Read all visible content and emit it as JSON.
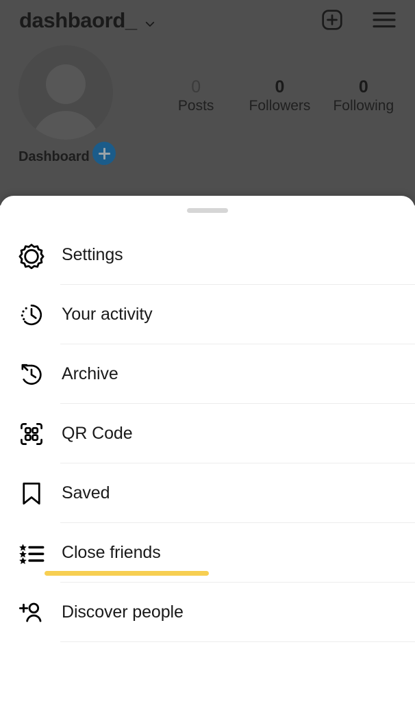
{
  "appbar": {
    "username": "dashbaord_",
    "chevron_icon": "chevron-down-icon",
    "new_post_icon": "plus-square-icon",
    "menu_icon": "hamburger-menu-icon"
  },
  "profile": {
    "display_name": "Dashboard",
    "avatar_icon": "default-avatar-icon",
    "add_story_icon": "plus-icon",
    "stats": [
      {
        "value": "0",
        "label": "Posts",
        "muted": true
      },
      {
        "value": "0",
        "label": "Followers",
        "muted": false
      },
      {
        "value": "0",
        "label": "Following",
        "muted": false
      }
    ]
  },
  "sheet": {
    "handle": "drag-handle",
    "items": [
      {
        "label": "Settings",
        "icon": "gear-icon",
        "highlighted": false
      },
      {
        "label": "Your activity",
        "icon": "activity-clock-icon",
        "highlighted": false
      },
      {
        "label": "Archive",
        "icon": "archive-history-icon",
        "highlighted": false
      },
      {
        "label": "QR Code",
        "icon": "qr-code-icon",
        "highlighted": false
      },
      {
        "label": "Saved",
        "icon": "bookmark-icon",
        "highlighted": false
      },
      {
        "label": "Close friends",
        "icon": "star-list-icon",
        "highlighted": true
      },
      {
        "label": "Discover people",
        "icon": "add-person-icon",
        "highlighted": false
      }
    ]
  },
  "colors": {
    "backdrop": "#4f4f4f",
    "sheet_background": "#ffffff",
    "highlight": "#f7cf52",
    "avatar_badge": "#1b5c8a",
    "divider": "#ececec",
    "text": "#1a1a1a"
  }
}
